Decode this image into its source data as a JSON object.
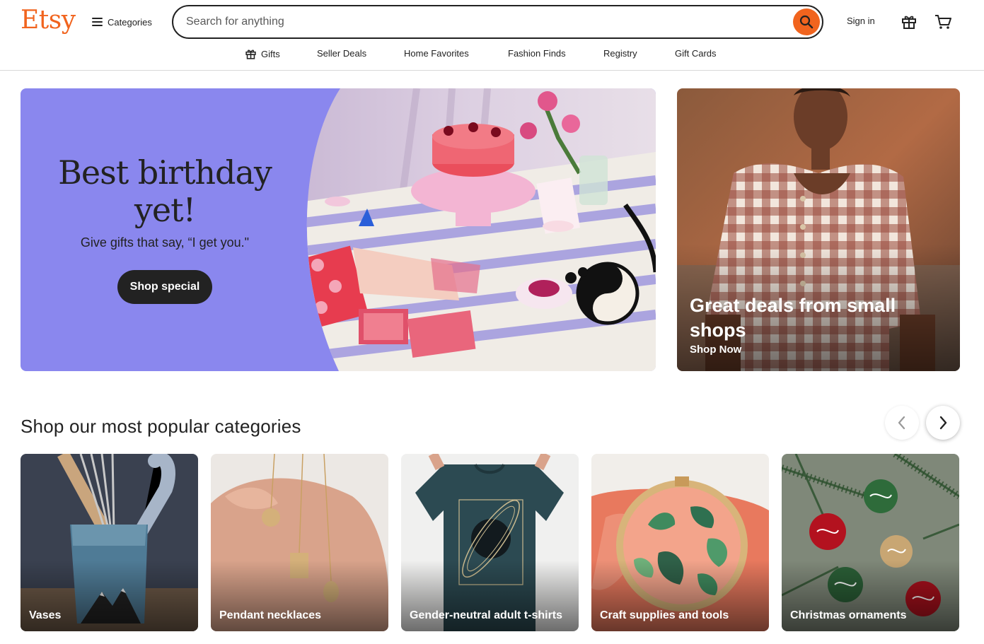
{
  "header": {
    "logo": "Etsy",
    "categories_label": "Categories",
    "search_placeholder": "Search for anything",
    "sign_in": "Sign in",
    "brand_color": "#f1641e",
    "icons": [
      "menu-icon",
      "search-icon",
      "gift-icon",
      "cart-icon"
    ]
  },
  "subnav": {
    "items": [
      {
        "label": "Gifts",
        "icon": "gift-icon"
      },
      {
        "label": "Seller Deals"
      },
      {
        "label": "Home Favorites"
      },
      {
        "label": "Fashion Finds"
      },
      {
        "label": "Registry"
      },
      {
        "label": "Gift Cards"
      }
    ]
  },
  "hero": {
    "title": "Best birthday yet!",
    "subtitle": "Give gifts that say, “I get you.\"",
    "button": "Shop special",
    "bg_color": "#8a87ee"
  },
  "deal": {
    "title": "Great deals from small shops",
    "link": "Shop Now"
  },
  "categories": {
    "title": "Shop our most popular categories",
    "items": [
      {
        "label": "Vases"
      },
      {
        "label": "Pendant necklaces"
      },
      {
        "label": "Gender-neutral adult t-shirts"
      },
      {
        "label": "Craft supplies and tools"
      },
      {
        "label": "Christmas ornaments"
      }
    ]
  }
}
